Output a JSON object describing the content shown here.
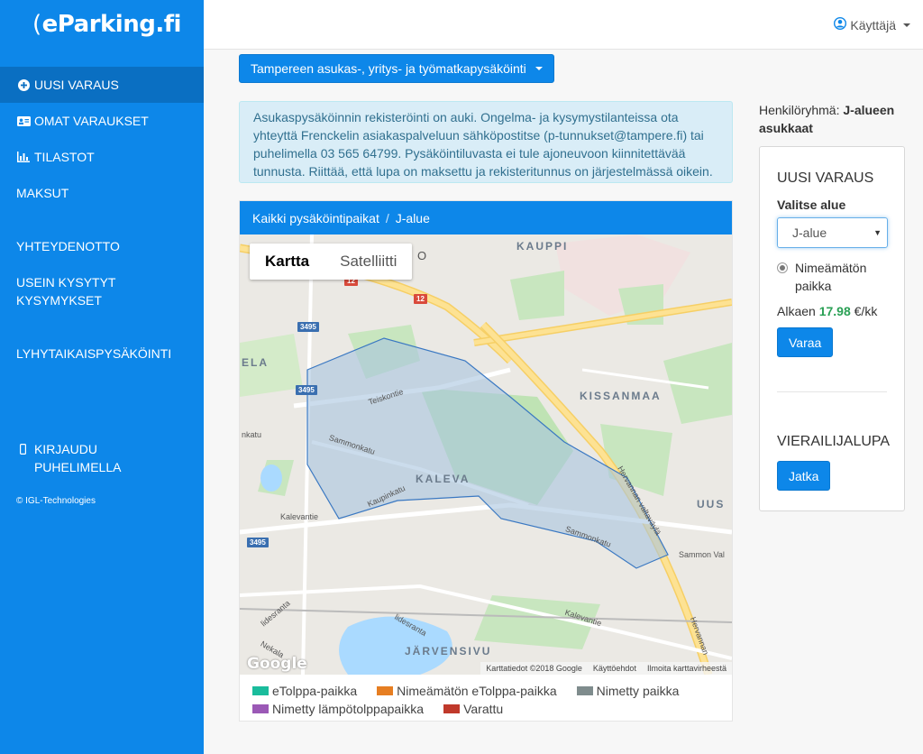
{
  "app": {
    "logo_bracket": "(",
    "logo_text": "eParking.fi"
  },
  "topbar": {
    "user_label": "Käyttäjä"
  },
  "sidebar": {
    "items": [
      {
        "label": "UUSI VARAUS",
        "icon": "plus-circle-icon"
      },
      {
        "label": "OMAT VARAUKSET",
        "icon": "id-card-icon"
      },
      {
        "label": "TILASTOT",
        "icon": "bar-chart-icon"
      },
      {
        "label": "MAKSUT"
      },
      {
        "label": "YHTEYDENOTTO"
      },
      {
        "label": "USEIN KYSYTYT KYSYMYKSET"
      },
      {
        "label": "LYHYTAIKAISPYSÄKÖINTI"
      },
      {
        "label": "KIRJAUDU PUHELIMELLA",
        "icon": "mobile-icon"
      }
    ],
    "copyright": "© IGL-Technologies"
  },
  "main": {
    "dropdown_label": "Tampereen asukas-, yritys- ja työmatkapysäköinti",
    "alert_text": "Asukaspysäköinnin rekisteröinti on auki. Ongelma- ja kysymystilanteissa ota yhteyttä Frenckelin asiakaspalveluun sähköpostitse (p-tunnukset@tampere.fi) tai puhelimella 03 565 64799. Pysäköintiluvasta ei tule ajoneuvoon kiinnitettävää tunnusta. Riittää, että lupa on maksettu ja rekisteritunnus on järjestelmässä oikein.",
    "breadcrumb": {
      "root": "Kaikki pysäköintipaikat",
      "separator": "/",
      "current": "J-alue"
    }
  },
  "map": {
    "type_map": "Kartta",
    "type_satellite": "Satelliitti",
    "google": "Google",
    "attribution": [
      "Karttatiedot ©2018 Google",
      "Käyttöehdot",
      "Ilmoita karttavirheestä"
    ],
    "district_labels": [
      "KAUPPI",
      "KISSANMAA",
      "KALEVA",
      "JÄRVENSIVU",
      "UUS",
      "ELA"
    ],
    "road_labels": [
      "Teiskontie",
      "Sammonkatu",
      "Kaupinkatu",
      "Kalevantie",
      "Hervannan valtaväylä",
      "Sammonkatu",
      "Kalevantie",
      "Sammon Val",
      "lidesranta",
      "lidesranta",
      "Nekala",
      "Hervannan",
      "nkatu",
      "O"
    ],
    "road_shields": [
      "3495",
      "3495",
      "3495",
      "12",
      "12"
    ],
    "colors": {
      "zone_fill": "#a8c4e0",
      "zone_stroke": "#3a78c2"
    }
  },
  "legend": [
    {
      "label": "eTolppa-paikka",
      "color": "#1abc9c"
    },
    {
      "label": "Nimeämätön eTolppa-paikka",
      "color": "#e67e22"
    },
    {
      "label": "Nimetty paikka",
      "color": "#7f8c8d"
    },
    {
      "label": "Nimetty lämpötolppapaikka",
      "color": "#9b59b6"
    },
    {
      "label": "Varattu",
      "color": "#c0392b"
    }
  ],
  "right": {
    "group_prefix": "Henkilöryhmä:",
    "group_name": "J-alueen asukkaat",
    "booking_title": "UUSI VARAUS",
    "select_area_label": "Valitse alue",
    "selected_area": "J-alue",
    "place_label": "Nimeämätön paikka",
    "price_prefix": "Alkaen",
    "price_value": "17.98",
    "price_suffix": "€/kk",
    "book_button": "Varaa",
    "visitor_title": "VIERAILIJALUPA",
    "continue_button": "Jatka"
  },
  "colors": {
    "primary": "#0d87e9",
    "alert_bg": "#d9edf7",
    "price_green": "#2aa055"
  }
}
